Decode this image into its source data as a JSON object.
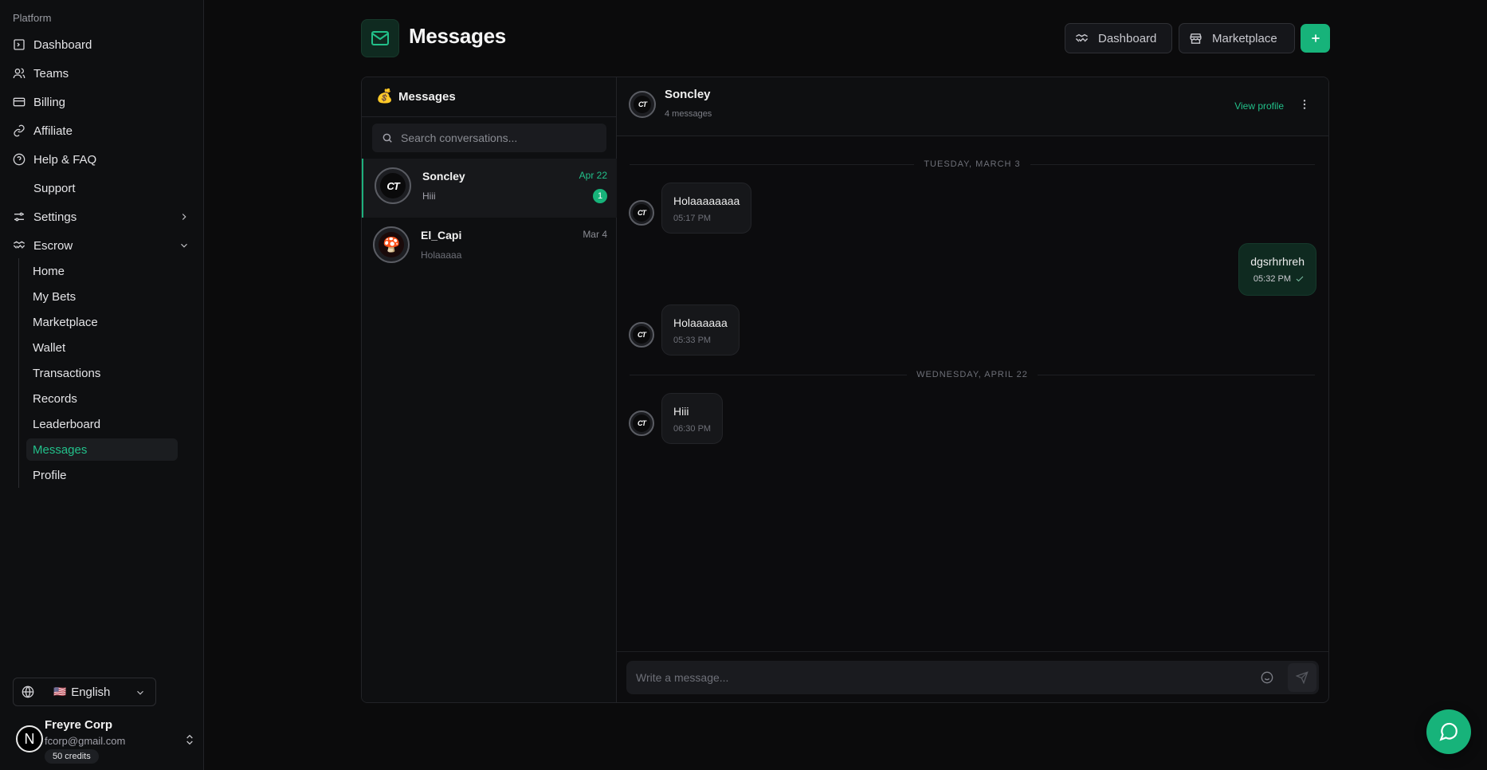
{
  "sidebar": {
    "section_label": "Platform",
    "nav": [
      {
        "label": "Dashboard",
        "icon": "dashboard-icon"
      },
      {
        "label": "Teams",
        "icon": "users-icon"
      },
      {
        "label": "Billing",
        "icon": "credit-card-icon"
      },
      {
        "label": "Affiliate",
        "icon": "link-icon"
      },
      {
        "label": "Help & FAQ",
        "icon": "help-circle-icon"
      },
      {
        "label": "Support",
        "icon": "support-icon"
      },
      {
        "label": "Settings",
        "icon": "sliders-icon"
      },
      {
        "label": "Escrow",
        "icon": "handshake-icon"
      }
    ],
    "escrow_items": [
      "Home",
      "My Bets",
      "Marketplace",
      "Wallet",
      "Transactions",
      "Records",
      "Leaderboard",
      "Messages",
      "Profile"
    ],
    "active_item": "Messages",
    "language": {
      "flag": "🇺🇸",
      "label": "English"
    },
    "user": {
      "initial": "N",
      "name": "Freyre Corp",
      "email": "fcorp@gmail.com",
      "credits": "50 credits"
    }
  },
  "header": {
    "title": "Messages",
    "buttons": {
      "dashboard": "Dashboard",
      "marketplace": "Marketplace"
    }
  },
  "conversations": {
    "title": "Messages",
    "search_placeholder": "Search conversations...",
    "items": [
      {
        "name": "Soncley",
        "date": "Apr 22",
        "preview": "Hiii",
        "unread": "1",
        "avatar_text": "CT",
        "active": true
      },
      {
        "name": "El_Capi",
        "date": "Mar 4",
        "preview": "Holaaaaa",
        "avatar_text": "🍄",
        "active": false
      }
    ]
  },
  "chat": {
    "name": "Soncley",
    "count": "4 messages",
    "view_profile": "View profile",
    "avatar_text": "CT",
    "days": [
      "TUESDAY, MARCH 3",
      "WEDNESDAY, APRIL 22"
    ],
    "messages": [
      {
        "text": "Holaaaaaaaa",
        "time": "05:17 PM",
        "from": "them"
      },
      {
        "text": "dgsrhrhreh",
        "time": "05:32 PM",
        "from": "me"
      },
      {
        "text": "Holaaaaaa",
        "time": "05:33 PM",
        "from": "them"
      },
      {
        "text": "Hiii",
        "time": "06:30 PM",
        "from": "them"
      }
    ],
    "composer_placeholder": "Write a message..."
  },
  "colors": {
    "accent": "#17b37a",
    "accent_text": "#22c08a",
    "background": "#0b0b0c"
  }
}
